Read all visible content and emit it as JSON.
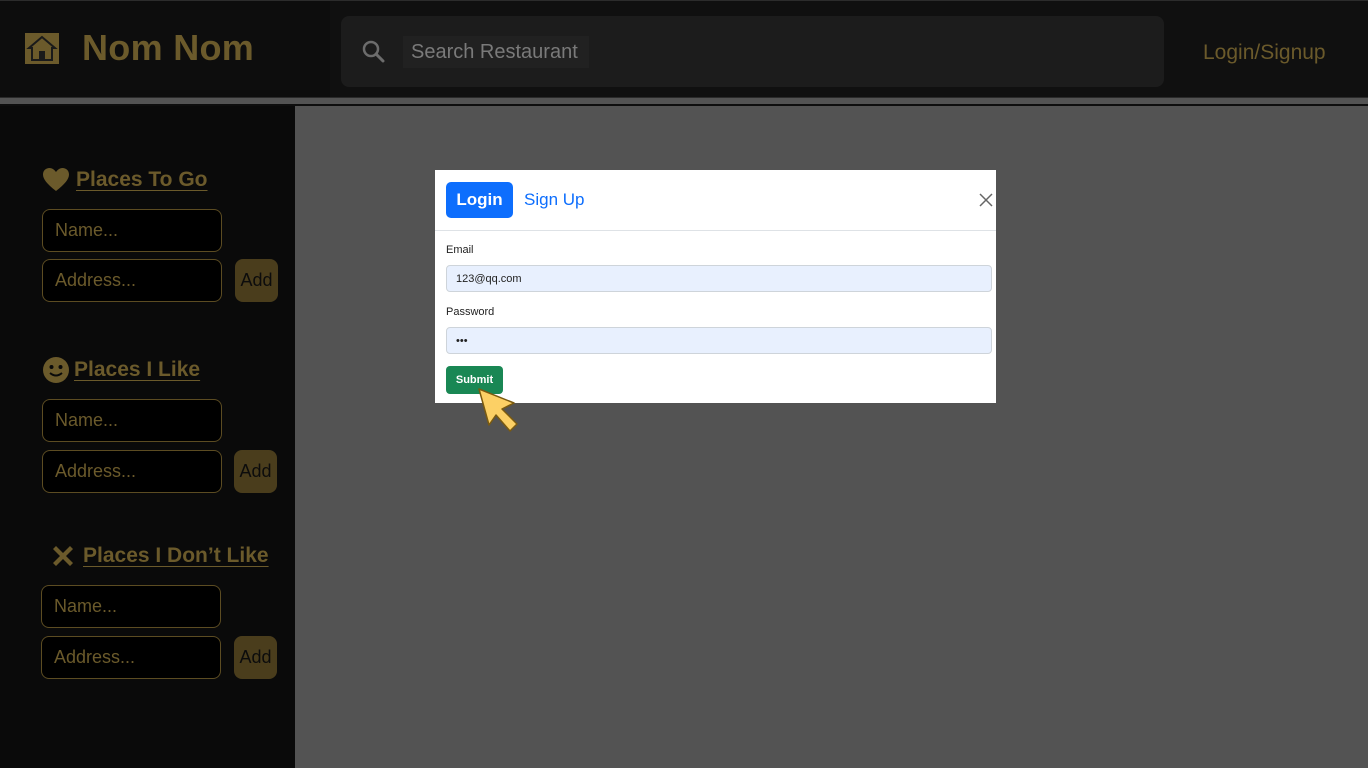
{
  "header": {
    "brand": "Nom Nom",
    "search_placeholder": "Search Restaurant",
    "login_link": "Login/Signup"
  },
  "sidebar": {
    "sections": [
      {
        "title": "Places To Go",
        "icon": "heart-icon",
        "name_placeholder": "Name...",
        "address_placeholder": "Address...",
        "add_label": "Add"
      },
      {
        "title": "Places I Like",
        "icon": "smiley-icon",
        "name_placeholder": "Name...",
        "address_placeholder": "Address...",
        "add_label": "Add"
      },
      {
        "title": "Places I Don’t Like",
        "icon": "cross-icon",
        "name_placeholder": "Name...",
        "address_placeholder": "Address...",
        "add_label": "Add"
      }
    ]
  },
  "modal": {
    "tab_login": "Login",
    "tab_signup": "Sign Up",
    "email_label": "Email",
    "email_value": "123@qq.com",
    "password_label": "Password",
    "password_value": "•••",
    "submit_label": "Submit"
  },
  "colors": {
    "accent_gold": "#6b5a2b",
    "primary_blue": "#0d6efd",
    "submit_green": "#198754",
    "overlay_gray": "#535353"
  }
}
